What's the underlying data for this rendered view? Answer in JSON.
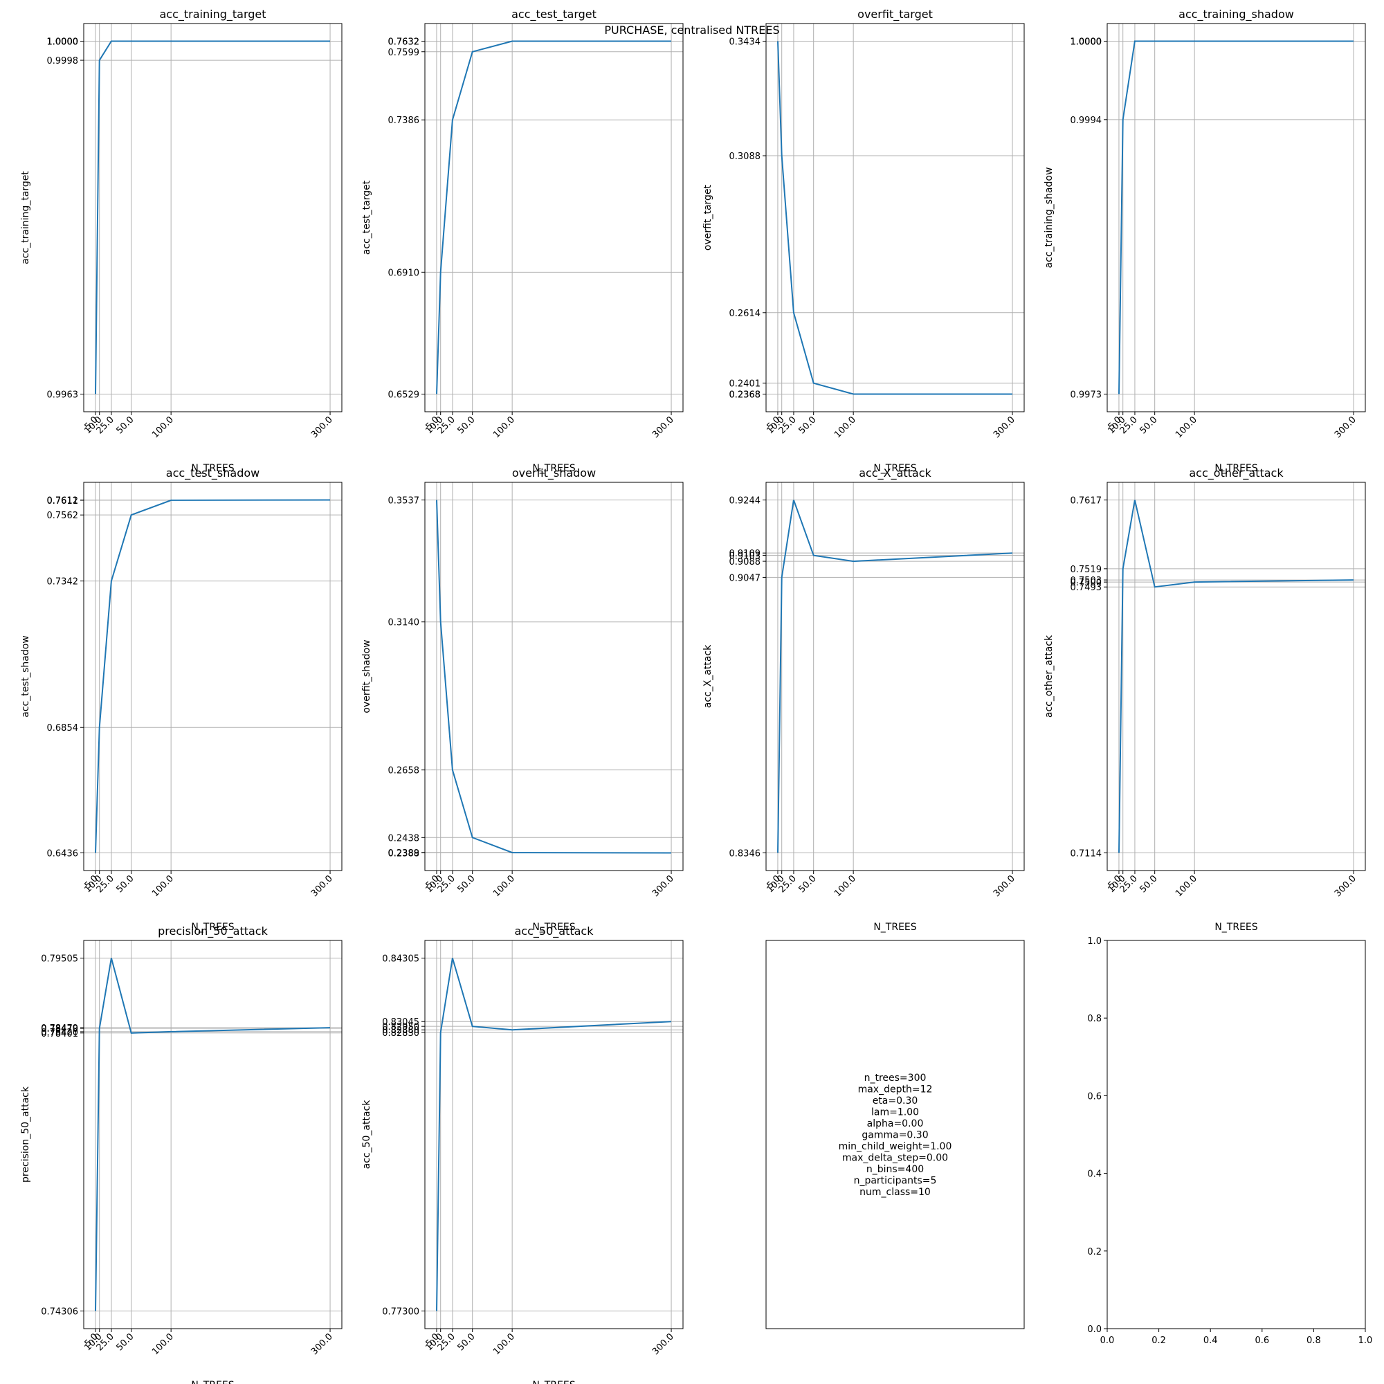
{
  "figure": {
    "suptitle": "PURCHASE, centralised NTREES",
    "line_color": "#1f77b4",
    "grid_color": "#b0b0b0"
  },
  "chart_data": [
    {
      "type": "line",
      "title": "acc_training_target",
      "xlabel": "N_TREES",
      "ylabel": "acc_training_target",
      "x": [
        5,
        10,
        25,
        50,
        100,
        300
      ],
      "y": [
        0.9963,
        0.9998,
        1.0,
        1.0,
        1.0,
        1.0
      ],
      "xticks": [
        "5.0",
        "10.0",
        "25.0",
        "50.0",
        "100.0",
        "300.0"
      ],
      "yticks": [
        "0.9963",
        "0.9998",
        "1.0000",
        "1.0000",
        "1.0000",
        "1.0000"
      ],
      "grid": true
    },
    {
      "type": "line",
      "title": "acc_test_target",
      "xlabel": "N_TREES",
      "ylabel": "acc_test_target",
      "x": [
        5,
        10,
        25,
        50,
        100,
        300
      ],
      "y": [
        0.6529,
        0.691,
        0.7386,
        0.7599,
        0.7632,
        0.7632
      ],
      "xticks": [
        "5.0",
        "10.0",
        "25.0",
        "50.0",
        "100.0",
        "300.0"
      ],
      "yticks": [
        "0.6529",
        "0.6910",
        "0.7386",
        "0.7599",
        "0.7632",
        "0.7632"
      ],
      "grid": true
    },
    {
      "type": "line",
      "title": "overfit_target",
      "xlabel": "N_TREES",
      "ylabel": "overfit_target",
      "x": [
        5,
        10,
        25,
        50,
        100,
        300
      ],
      "y": [
        0.3434,
        0.3088,
        0.2614,
        0.2401,
        0.2368,
        0.2368
      ],
      "xticks": [
        "5.0",
        "10.0",
        "25.0",
        "50.0",
        "100.0",
        "300.0"
      ],
      "yticks": [
        "0.3434",
        "0.3088",
        "0.2614",
        "0.2401",
        "0.2368",
        "0.2368"
      ],
      "grid": true
    },
    {
      "type": "line",
      "title": "acc_training_shadow",
      "xlabel": "N_TREES",
      "ylabel": "acc_training_shadow",
      "x": [
        5,
        10,
        25,
        50,
        100,
        300
      ],
      "y": [
        0.9973,
        0.9994,
        1.0,
        1.0,
        1.0,
        1.0
      ],
      "xticks": [
        "5.0",
        "10.0",
        "25.0",
        "50.0",
        "100.0",
        "300.0"
      ],
      "yticks": [
        "0.9973",
        "0.9994",
        "1.0000",
        "1.0000",
        "1.0000",
        "1.0000"
      ],
      "grid": true
    },
    {
      "type": "line",
      "title": "acc_test_shadow",
      "xlabel": "N_TREES",
      "ylabel": "acc_test_shadow",
      "x": [
        5,
        10,
        25,
        50,
        100,
        300
      ],
      "y": [
        0.6436,
        0.6854,
        0.7342,
        0.7562,
        0.7611,
        0.7612
      ],
      "xticks": [
        "5.0",
        "10.0",
        "25.0",
        "50.0",
        "100.0",
        "300.0"
      ],
      "yticks": [
        "0.6436",
        "0.6854",
        "0.7342",
        "0.7562",
        "0.7611",
        "0.7612"
      ],
      "grid": true
    },
    {
      "type": "line",
      "title": "overfit_shadow",
      "xlabel": "N_TREES",
      "ylabel": "overfit_shadow",
      "x": [
        5,
        10,
        25,
        50,
        100,
        300
      ],
      "y": [
        0.3537,
        0.314,
        0.2658,
        0.2438,
        0.2389,
        0.2388
      ],
      "xticks": [
        "5.0",
        "10.0",
        "25.0",
        "50.0",
        "100.0",
        "300.0"
      ],
      "yticks": [
        "0.3537",
        "0.3140",
        "0.2658",
        "0.2438",
        "0.2389",
        "0.2388"
      ],
      "grid": true
    },
    {
      "type": "line",
      "title": "acc_X_attack",
      "xlabel": "N_TREES",
      "ylabel": "acc_X_attack",
      "x": [
        5,
        10,
        25,
        50,
        100,
        300
      ],
      "y": [
        0.8346,
        0.9047,
        0.9244,
        0.9103,
        0.9088,
        0.9109
      ],
      "xticks": [
        "5.0",
        "10.0",
        "25.0",
        "50.0",
        "100.0",
        "300.0"
      ],
      "yticks": [
        "0.8346",
        "0.9047",
        "0.9244",
        "0.9103",
        "0.9088",
        "0.9109"
      ],
      "grid": true
    },
    {
      "type": "line",
      "title": "acc_other_attack",
      "xlabel": "N_TREES",
      "ylabel": "acc_other_attack",
      "x": [
        5,
        10,
        25,
        50,
        100,
        300
      ],
      "y": [
        0.7114,
        0.7519,
        0.7617,
        0.7493,
        0.75,
        0.7503
      ],
      "xticks": [
        "5.0",
        "10.0",
        "25.0",
        "50.0",
        "100.0",
        "300.0"
      ],
      "yticks": [
        "0.7114",
        "0.7519",
        "0.7617",
        "0.7493",
        "0.7500",
        "0.7503"
      ],
      "grid": true
    },
    {
      "type": "line",
      "title": "precision_50_attack",
      "xlabel": "N_TREES",
      "ylabel": "precision_50_attack",
      "x": [
        5,
        10,
        25,
        50,
        100,
        300
      ],
      "y": [
        0.74306,
        0.7847,
        0.79505,
        0.78401,
        0.7842,
        0.78479
      ],
      "xticks": [
        "5.0",
        "10.0",
        "25.0",
        "50.0",
        "100.0",
        "300.0"
      ],
      "yticks": [
        "0.74306",
        "0.78470",
        "0.79505",
        "0.78401",
        "0.78420",
        "0.78479"
      ],
      "grid": true
    },
    {
      "type": "line",
      "title": "acc_50_attack",
      "xlabel": "N_TREES",
      "ylabel": "acc_50_attack",
      "x": [
        5,
        10,
        25,
        50,
        100,
        300
      ],
      "y": [
        0.773,
        0.8283,
        0.84305,
        0.8295,
        0.8288,
        0.83045
      ],
      "xticks": [
        "5.0",
        "10.0",
        "25.0",
        "50.0",
        "100.0",
        "300.0"
      ],
      "yticks": [
        "0.77300",
        "0.82830",
        "0.84305",
        "0.82950",
        "0.82880",
        "0.83045"
      ],
      "grid": true
    }
  ],
  "params_text": [
    "n_trees=300",
    "max_depth=12",
    "eta=0.30",
    "lam=1.00",
    "alpha=0.00",
    "gamma=0.30",
    "min_child_weight=1.00",
    "max_delta_step=0.00",
    "n_bins=400",
    "n_participants=5",
    "num_class=10"
  ],
  "empty_axes": {
    "xticks": [
      "0.0",
      "0.2",
      "0.4",
      "0.6",
      "0.8",
      "1.0"
    ],
    "yticks": [
      "0.0",
      "0.2",
      "0.4",
      "0.6",
      "0.8",
      "1.0"
    ]
  }
}
